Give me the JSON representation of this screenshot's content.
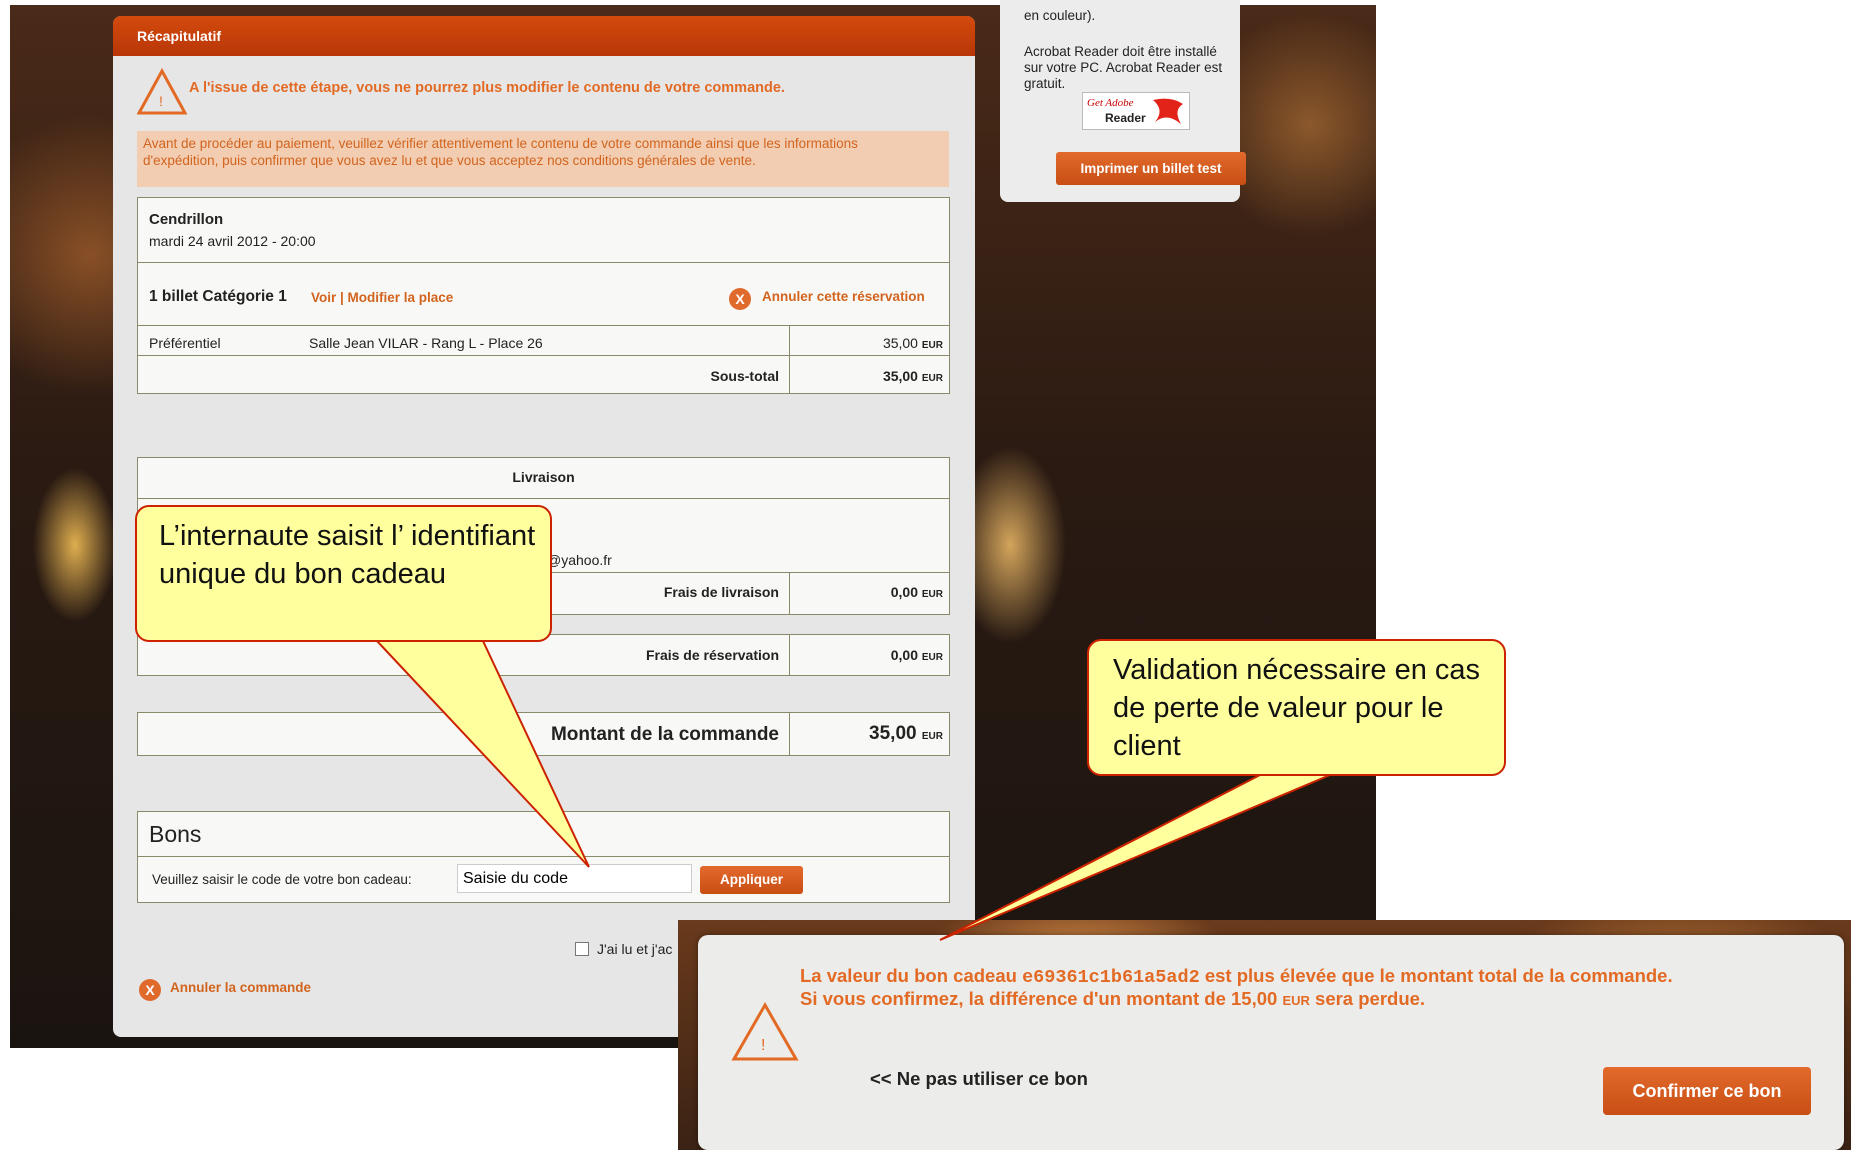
{
  "header": {
    "title": "Récapitulatif"
  },
  "warning": {
    "text": "A l'issue de cette étape, vous ne pourrez plus modifier le contenu de votre commande."
  },
  "info": {
    "line1": "Avant de procéder au paiement, veuillez vérifier attentivement le contenu de votre commande ainsi que les informations",
    "line2": "d'expédition, puis confirmer que vous avez lu et que vous acceptez nos conditions générales de vente."
  },
  "event": {
    "title": "Cendrillon",
    "datetime": "mardi 24 avril 2012 - 20:00",
    "tickets_label": "1 billet Catégorie 1",
    "view_modify_link": "Voir | Modifier la place",
    "cancel_reservation_link": "Annuler cette réservation",
    "row": {
      "rate": "Préférentiel",
      "seat": "Salle Jean VILAR - Rang L - Place 26",
      "amount": "35,00"
    },
    "subtotal_label": "Sous-total",
    "subtotal_amount": "35,00"
  },
  "currency": "EUR",
  "delivery": {
    "title": "Livraison",
    "partial_char": "t",
    "email_partial": "@yahoo.fr",
    "shipping_label": "Frais de livraison",
    "shipping_amount": "0,00",
    "reservation_label": "Frais de réservation",
    "reservation_amount": "0,00"
  },
  "order": {
    "total_label": "Montant de la commande",
    "total_amount": "35,00"
  },
  "vouchers": {
    "title": "Bons",
    "prompt": "Veuillez saisir le code de votre bon cadeau:",
    "input_value": "Saisie du code",
    "apply_button": "Appliquer"
  },
  "terms": {
    "checkbox_label": "J'ai lu et j'ac"
  },
  "cancel_order_link": "Annuler la commande",
  "side": {
    "top_text": "en couleur).",
    "acrobat_text": "Acrobat Reader doit être installé sur votre PC. Acrobat Reader est gratuit.",
    "adobe_get": "Get Adobe",
    "adobe_reader": "Reader",
    "print_test_button": "Imprimer un billet test"
  },
  "callouts": {
    "left": "L’internaute saisit l’ identifiant unique du bon cadeau",
    "right": "Validation nécessaire en cas de perte de valeur pour le client"
  },
  "popup": {
    "line1_prefix": "La valeur du bon cadeau",
    "code": "e69361c1b61a5ad2",
    "line1_suffix": "est plus élevée que le montant total de la commande.",
    "line2_prefix": "Si vous confirmez, la différence d'un montant de 15,00",
    "line2_currency": "EUR",
    "line2_suffix": "sera perdue.",
    "skip_link": "<< Ne pas utiliser ce bon",
    "confirm_button": "Confirmer ce bon"
  },
  "colors": {
    "accent": "#d2641e",
    "header": "#c4400a",
    "callout_fill": "#ffff9e",
    "callout_border": "#cc2200"
  }
}
